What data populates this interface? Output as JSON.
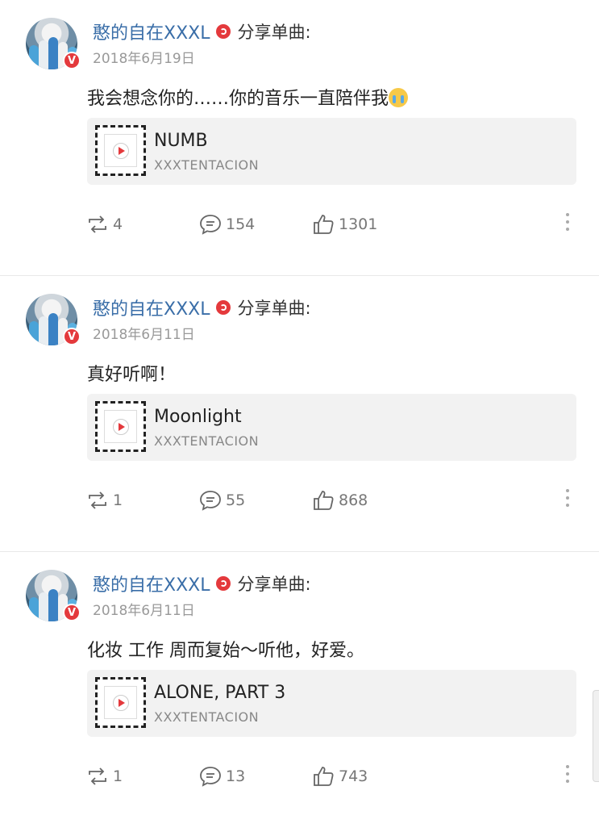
{
  "posts": [
    {
      "username": "憨的自在XXXL",
      "action": "分享单曲:",
      "date": "2018年6月19日",
      "content": "我会想念你的……你的音乐一直陪伴我",
      "has_emoji": true,
      "song_title": "NUMB",
      "song_artist": "XXXTENTACION",
      "reposts": "4",
      "comments": "154",
      "likes": "1301"
    },
    {
      "username": "憨的自在XXXL",
      "action": "分享单曲:",
      "date": "2018年6月11日",
      "content": "真好听啊！",
      "has_emoji": false,
      "song_title": "Moonlight",
      "song_artist": "XXXTENTACION",
      "reposts": "1",
      "comments": "55",
      "likes": "868"
    },
    {
      "username": "憨的自在XXXL",
      "action": "分享单曲:",
      "date": "2018年6月11日",
      "content": "化妆 工作 周而复始～听他，好爱。",
      "has_emoji": false,
      "song_title": "ALONE, PART 3",
      "song_artist": "XXXTENTACION",
      "reposts": "1",
      "comments": "13",
      "likes": "743"
    }
  ],
  "avatar_badge": "V",
  "colors": {
    "username": "#3a6ea8",
    "accent": "#e4393c",
    "card_bg": "#f2f2f2",
    "meta": "#999999"
  },
  "icons": [
    "repost-icon",
    "comment-icon",
    "like-icon",
    "more-icon",
    "play-icon",
    "music-badge-icon"
  ]
}
